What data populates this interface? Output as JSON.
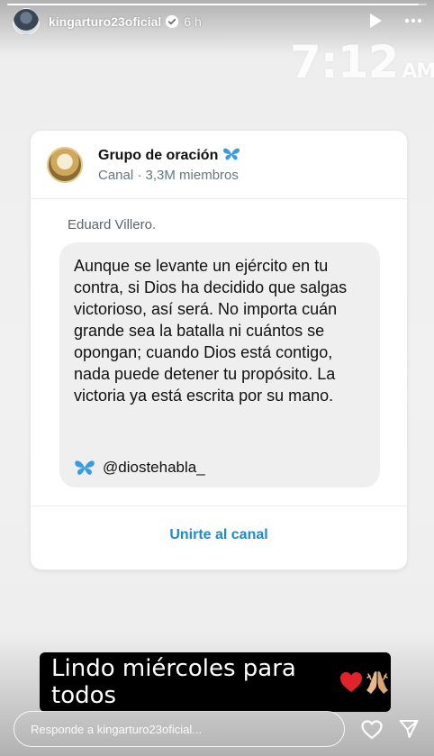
{
  "story": {
    "progress": 0.98,
    "username": "kingarturo23oficial",
    "time_ago": "6 h",
    "icons": [
      "verified-icon",
      "play-icon",
      "more-icon",
      "heart-icon",
      "send-icon"
    ]
  },
  "overlay": {
    "clock_time": "7:12",
    "clock_ampm": "AM"
  },
  "card": {
    "channel_name": "Grupo de oración",
    "channel_meta": "Canal · 3,3M miembros",
    "author": "Eduard Villero.",
    "message": "Aunque se levante un ejército en tu contra, si Dios ha decidido que salgas victorioso, así será. No importa cuán grande sea la batalla ni cuántos se opongan; cuando Dios está contigo, nada puede detener tu propósito. La victoria ya está escrita por su mano.",
    "handle": "@diostehabla_",
    "join_label": "Unirte al canal",
    "accent_color": "#1a8bd8",
    "butterfly_color": "#3a9be0"
  },
  "caption": {
    "text": "Lindo miércoles para todos",
    "emojis": [
      "red-heart-icon",
      "praying-hands-icon"
    ]
  },
  "reply": {
    "placeholder": "Responde a kingarturo23oficial..."
  }
}
